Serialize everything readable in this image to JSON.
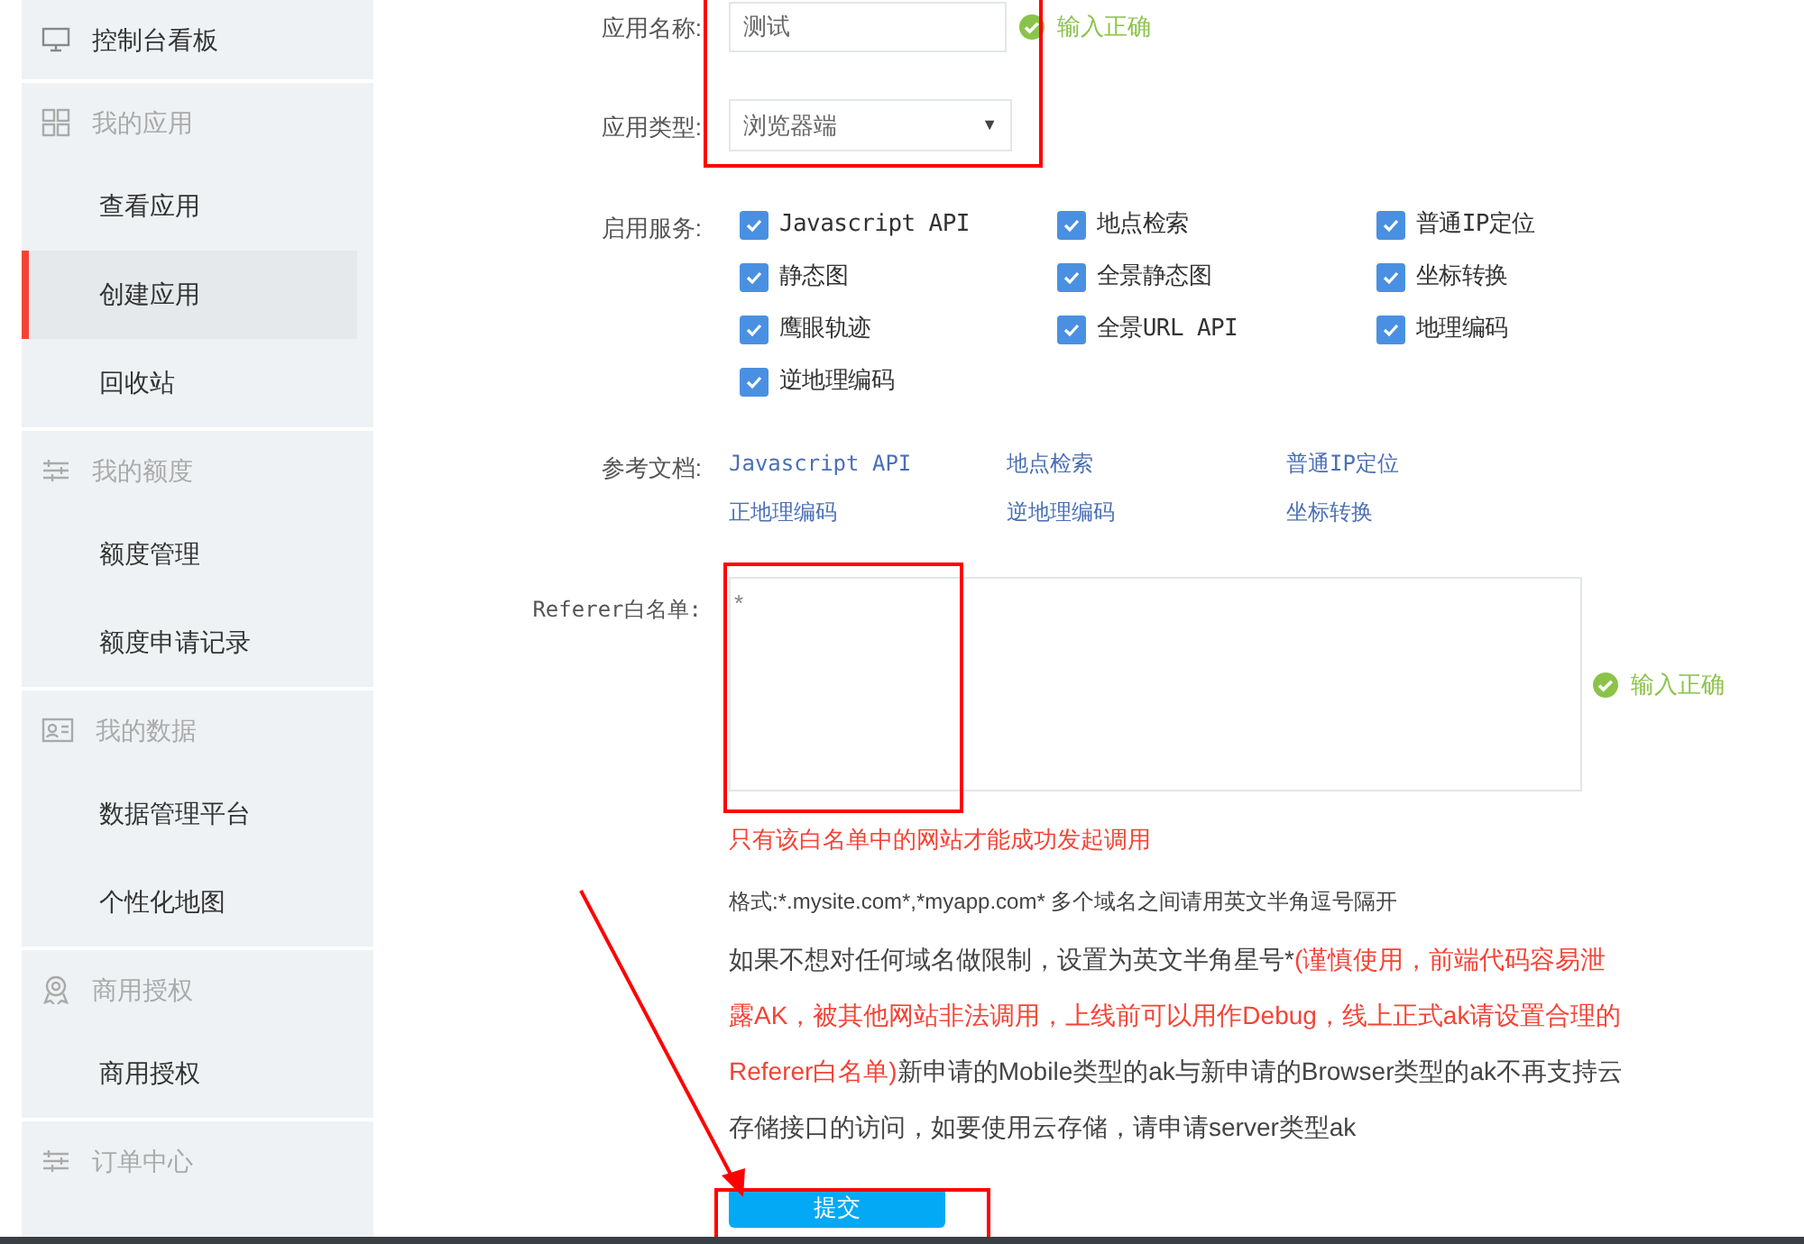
{
  "sidebar": {
    "groups": [
      {
        "header": {
          "label": "控制台看板",
          "dimmed": false
        }
      },
      {
        "header": {
          "label": "我的应用",
          "dimmed": true
        },
        "items": [
          {
            "label": "查看应用",
            "selected": false
          },
          {
            "label": "创建应用",
            "selected": true
          },
          {
            "label": "回收站",
            "selected": false
          }
        ]
      },
      {
        "header": {
          "label": "我的额度",
          "dimmed": true
        },
        "items": [
          {
            "label": "额度管理",
            "selected": false
          },
          {
            "label": "额度申请记录",
            "selected": false
          }
        ]
      },
      {
        "header": {
          "label": "我的数据",
          "dimmed": true
        },
        "items": [
          {
            "label": "数据管理平台",
            "selected": false
          },
          {
            "label": "个性化地图",
            "selected": false
          }
        ]
      },
      {
        "header": {
          "label": "商用授权",
          "dimmed": true
        },
        "items": [
          {
            "label": "商用授权",
            "selected": false
          }
        ]
      },
      {
        "header": {
          "label": "订单中心",
          "dimmed": true
        }
      }
    ]
  },
  "form": {
    "app_name": {
      "label": "应用名称:",
      "value": "测试",
      "validation": "输入正确"
    },
    "app_type": {
      "label": "应用类型:",
      "value": "浏览器端",
      "caret": "▼"
    },
    "services": {
      "label": "启用服务:",
      "options": [
        {
          "label": "Javascript API",
          "checked": true
        },
        {
          "label": "地点检索",
          "checked": true
        },
        {
          "label": "普通IP定位",
          "checked": true
        },
        {
          "label": "静态图",
          "checked": true
        },
        {
          "label": "全景静态图",
          "checked": true
        },
        {
          "label": "坐标转换",
          "checked": true
        },
        {
          "label": "鹰眼轨迹",
          "checked": true
        },
        {
          "label": "全景URL API",
          "checked": true
        },
        {
          "label": "地理编码",
          "checked": true
        },
        {
          "label": "逆地理编码",
          "checked": true
        }
      ]
    },
    "docs": {
      "label": "参考文档:",
      "links": [
        "Javascript API",
        "地点检索",
        "普通IP定位",
        "正地理编码",
        "逆地理编码",
        "坐标转换"
      ]
    },
    "referer": {
      "label": "Referer白名单:",
      "value": "*",
      "validation": "输入正确",
      "warning": "只有该白名单中的网站才能成功发起调用",
      "format_note": "格式:*.mysite.com*,*myapp.com* 多个域名之间请用英文半角逗号隔开",
      "note_segments": [
        {
          "text": "如果不想对任何域名做限制，设置为英文半角星号*",
          "emphasis": false
        },
        {
          "text": "(谨慎使用，前端代码容易泄露AK，被其他网站非法调用，上线前可以用作Debug，线上正式ak请设置合理的Referer白名单)",
          "emphasis": true
        },
        {
          "text": "新申请的Mobile类型的ak与新申请的Browser类型的ak不再支持云存储接口的访问，如要使用云存储，请申请server类型ak",
          "emphasis": false
        }
      ]
    },
    "submit": "提交"
  }
}
